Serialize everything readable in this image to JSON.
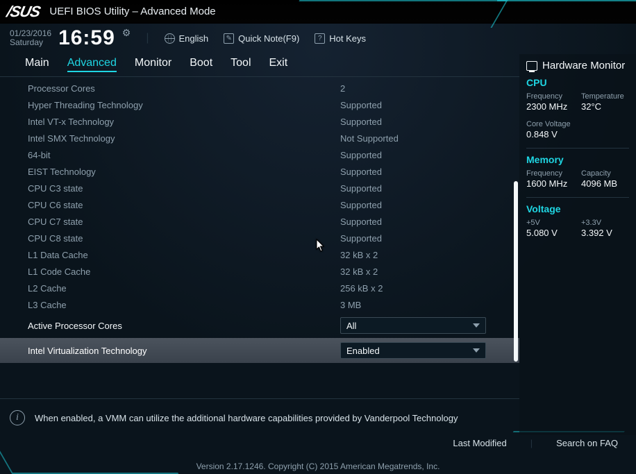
{
  "brand": {
    "logo": "/SUS",
    "title": "UEFI BIOS Utility – Advanced Mode"
  },
  "subbar": {
    "date": "01/23/2016",
    "day": "Saturday",
    "time": "16:59",
    "language": "English",
    "quicknote": "Quick Note(F9)",
    "hotkeys": "Hot Keys"
  },
  "tabs": [
    "Main",
    "Advanced",
    "Monitor",
    "Boot",
    "Tool",
    "Exit"
  ],
  "active_tab": "Advanced",
  "rows": [
    {
      "label": "Processor Cores",
      "value": "2"
    },
    {
      "label": "Hyper Threading  Technology",
      "value": "Supported"
    },
    {
      "label": "Intel VT-x Technology",
      "value": "Supported"
    },
    {
      "label": "Intel SMX Technology",
      "value": "Not Supported"
    },
    {
      "label": "64-bit",
      "value": "Supported"
    },
    {
      "label": "EIST Technology",
      "value": "Supported"
    },
    {
      "label": "CPU C3 state",
      "value": "Supported"
    },
    {
      "label": "CPU C6 state",
      "value": "Supported"
    },
    {
      "label": "CPU C7 state",
      "value": "Supported"
    },
    {
      "label": "CPU C8 state",
      "value": "Supported"
    },
    {
      "label": "L1 Data Cache",
      "value": "32 kB x 2"
    },
    {
      "label": "L1 Code Cache",
      "value": "32 kB x 2"
    },
    {
      "label": "L2 Cache",
      "value": "256 kB x 2"
    },
    {
      "label": "L3 Cache",
      "value": "3 MB"
    }
  ],
  "configs": [
    {
      "label": "Active Processor Cores",
      "value": "All",
      "highlight": false
    },
    {
      "label": "Intel Virtualization Technology",
      "value": "Enabled",
      "highlight": true
    }
  ],
  "help_text": "When enabled, a VMM can utilize the additional hardware capabilities provided by Vanderpool Technology",
  "hw": {
    "title": "Hardware Monitor",
    "cpu": {
      "title": "CPU",
      "freq_k": "Frequency",
      "freq_v": "2300 MHz",
      "temp_k": "Temperature",
      "temp_v": "32°C",
      "cv_k": "Core Voltage",
      "cv_v": "0.848 V"
    },
    "mem": {
      "title": "Memory",
      "freq_k": "Frequency",
      "freq_v": "1600 MHz",
      "cap_k": "Capacity",
      "cap_v": "4096 MB"
    },
    "volt": {
      "title": "Voltage",
      "a_k": "+5V",
      "a_v": "5.080 V",
      "b_k": "+3.3V",
      "b_v": "3.392 V"
    }
  },
  "footer": {
    "last_modified": "Last Modified",
    "faq": "Search on FAQ",
    "version": "Version 2.17.1246. Copyright (C) 2015 American Megatrends, Inc."
  }
}
